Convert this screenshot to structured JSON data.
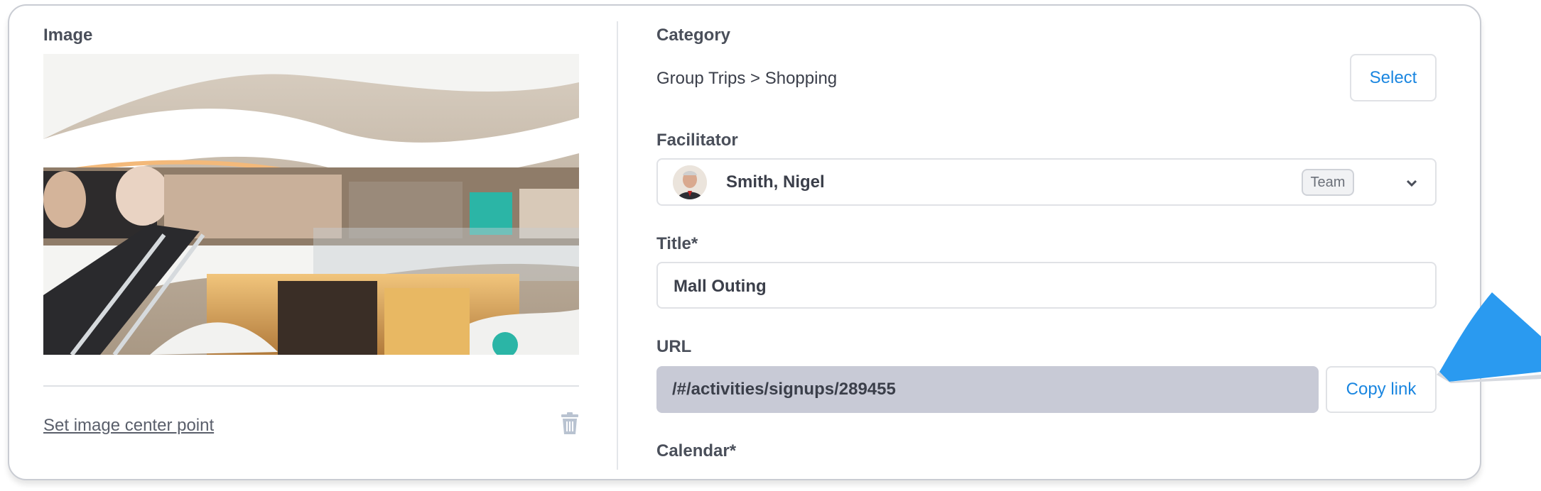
{
  "image_panel": {
    "label": "Image",
    "set_center_link": "Set image center point"
  },
  "category": {
    "label": "Category",
    "value": "Group Trips > Shopping",
    "select_button": "Select"
  },
  "facilitator": {
    "label": "Facilitator",
    "name": "Smith, Nigel",
    "badge": "Team"
  },
  "title": {
    "label": "Title*",
    "value": "Mall Outing"
  },
  "url": {
    "label": "URL",
    "value": "/#/activities/signups/289455",
    "copy_button": "Copy link"
  },
  "calendar": {
    "label": "Calendar*"
  },
  "colors": {
    "accent": "#1a86e0",
    "disabled_field": "#c8cad6",
    "pointer": "#2a9af0"
  },
  "icons": [
    "trash-icon",
    "chevron-down-icon",
    "avatar",
    "mall-photo"
  ]
}
